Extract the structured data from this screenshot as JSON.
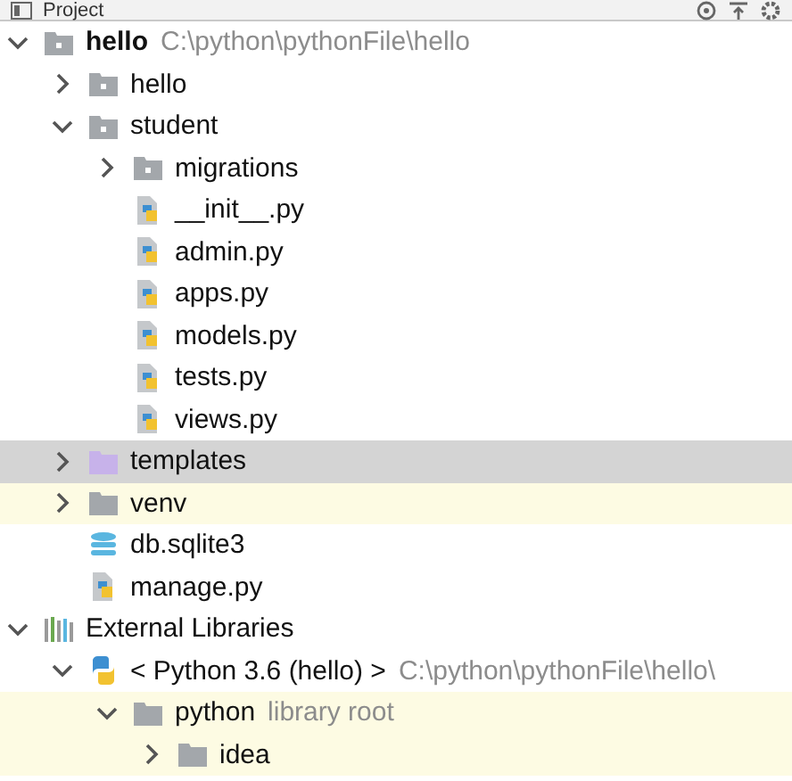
{
  "panel": {
    "title": "Project"
  },
  "tree": [
    {
      "kind": "module",
      "name": "hello",
      "bold": true,
      "detail": "C:\\python\\pythonFile\\hello",
      "expanded": true,
      "selected": false,
      "highlighted": false,
      "children": [
        {
          "kind": "module",
          "name": "hello",
          "expanded": false,
          "selected": false,
          "highlighted": false
        },
        {
          "kind": "module",
          "name": "student",
          "expanded": true,
          "selected": false,
          "highlighted": false,
          "children": [
            {
              "kind": "module",
              "name": "migrations",
              "expanded": false,
              "selected": false,
              "highlighted": false
            },
            {
              "kind": "python",
              "name": "__init__.py",
              "selected": false,
              "highlighted": false
            },
            {
              "kind": "python",
              "name": "admin.py",
              "selected": false,
              "highlighted": false
            },
            {
              "kind": "python",
              "name": "apps.py",
              "selected": false,
              "highlighted": false
            },
            {
              "kind": "python",
              "name": "models.py",
              "selected": false,
              "highlighted": false
            },
            {
              "kind": "python",
              "name": "tests.py",
              "selected": false,
              "highlighted": false
            },
            {
              "kind": "python",
              "name": "views.py",
              "selected": false,
              "highlighted": false
            }
          ]
        },
        {
          "kind": "templates",
          "name": "templates",
          "expanded": false,
          "selected": true,
          "highlighted": false
        },
        {
          "kind": "folder",
          "name": "venv",
          "expanded": false,
          "selected": false,
          "highlighted": true
        },
        {
          "kind": "database",
          "name": "db.sqlite3",
          "selected": false,
          "highlighted": false
        },
        {
          "kind": "python",
          "name": "manage.py",
          "selected": false,
          "highlighted": false
        }
      ]
    },
    {
      "kind": "libraries",
      "name": "External Libraries",
      "expanded": true,
      "selected": false,
      "highlighted": false,
      "children": [
        {
          "kind": "sdk",
          "name": "< Python 3.6 (hello) >",
          "detail": "C:\\python\\pythonFile\\hello\\",
          "expanded": true,
          "selected": false,
          "highlighted": false,
          "children": [
            {
              "kind": "folder",
              "name": "python",
              "detail": "library root",
              "expanded": true,
              "selected": false,
              "highlighted": true,
              "children": [
                {
                  "kind": "folder",
                  "name": "idea",
                  "expanded": false,
                  "selected": false,
                  "highlighted": true
                }
              ]
            }
          ]
        }
      ]
    }
  ]
}
